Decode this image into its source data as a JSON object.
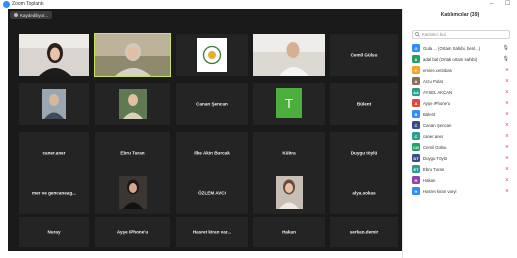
{
  "window": {
    "title": "Zoom Toplantı",
    "minimize": "–",
    "maximize": "☐"
  },
  "recording": {
    "label": "Kaydediliyor..."
  },
  "tiles": [
    {
      "name": "",
      "kind": "video"
    },
    {
      "name": "",
      "kind": "video"
    },
    {
      "name": "",
      "kind": "logo"
    },
    {
      "name": "",
      "kind": "video"
    },
    {
      "name": "Cemil Gülsu",
      "kind": "name"
    },
    {
      "name": "",
      "kind": "photo"
    },
    {
      "name": "",
      "kind": "photo"
    },
    {
      "name": "Canan Şencan",
      "kind": "name"
    },
    {
      "name": "",
      "kind": "avatar",
      "letter": "T"
    },
    {
      "name": "Bülent",
      "kind": "name"
    },
    {
      "name": "caner.aner",
      "kind": "name"
    },
    {
      "name": "Ebru Turan",
      "kind": "name"
    },
    {
      "name": "Ilke Akin Burcak",
      "kind": "name"
    },
    {
      "name": "Kübra",
      "kind": "name"
    },
    {
      "name": "Duygu töylü",
      "kind": "name"
    },
    {
      "name": "mer ve gencaneag...",
      "kind": "name"
    },
    {
      "name": "",
      "kind": "photo"
    },
    {
      "name": "ÖZLEM AVCI",
      "kind": "name"
    },
    {
      "name": "",
      "kind": "photo"
    },
    {
      "name": "alya.sokas",
      "kind": "name"
    },
    {
      "name": "Nuray",
      "kind": "name"
    },
    {
      "name": "Ayşe iPhone'u",
      "kind": "name"
    },
    {
      "name": "Hasret kiran var...",
      "kind": "name"
    },
    {
      "name": "Hakan",
      "kind": "name"
    },
    {
      "name": "serkan.demir",
      "kind": "name"
    }
  ],
  "sidebar": {
    "title": "Katılımcılar (39)",
    "search_placeholder": "Katılımcı bul",
    "participants": [
      {
        "initials": "G",
        "color": "#2d8cff",
        "name": "Gula ... (Ortam Sahibi, benl...)",
        "muted": false
      },
      {
        "initials": "A",
        "color": "#21a366",
        "name": "adal bal (Ortak ortam sahibi)",
        "muted": false
      },
      {
        "initials": "E",
        "color": "#f5a623",
        "name": "emine.cetinbas",
        "muted": true
      },
      {
        "initials": "A",
        "color": "#8e6f5a",
        "name": "Arzu Polat",
        "muted": true
      },
      {
        "initials": "AA",
        "color": "#2a9d8f",
        "name": "AYSEL AKCAN",
        "muted": true
      },
      {
        "initials": "A",
        "color": "#e04a3a",
        "name": "Ayşe iPhone'u",
        "muted": true
      },
      {
        "initials": "B",
        "color": "#2d8cff",
        "name": "Bülent",
        "muted": true
      },
      {
        "initials": "C",
        "color": "#3b4a8f",
        "name": "Canan Şencan",
        "muted": true
      },
      {
        "initials": "C",
        "color": "#2a9d8f",
        "name": "caner.aner",
        "muted": true
      },
      {
        "initials": "CG",
        "color": "#21a366",
        "name": "Cemil Gülsu",
        "muted": true
      },
      {
        "initials": "DT",
        "color": "#3b4a8f",
        "name": "Duygu Töylü",
        "muted": true
      },
      {
        "initials": "ET",
        "color": "#2a9d8f",
        "name": "Ebru Turan",
        "muted": true
      },
      {
        "initials": "H",
        "color": "#8e44ad",
        "name": "Hakan",
        "muted": true
      },
      {
        "initials": "H",
        "color": "#2d8cff",
        "name": "Hasret kiran varyi",
        "muted": true
      }
    ]
  },
  "colors": {
    "meeting_bg": "#1a1a1a",
    "tile_bg": "#242424",
    "active_speaker": "#c6e15b",
    "muted_icon": "#e03a3a",
    "zoom_blue": "#2d8cff"
  }
}
